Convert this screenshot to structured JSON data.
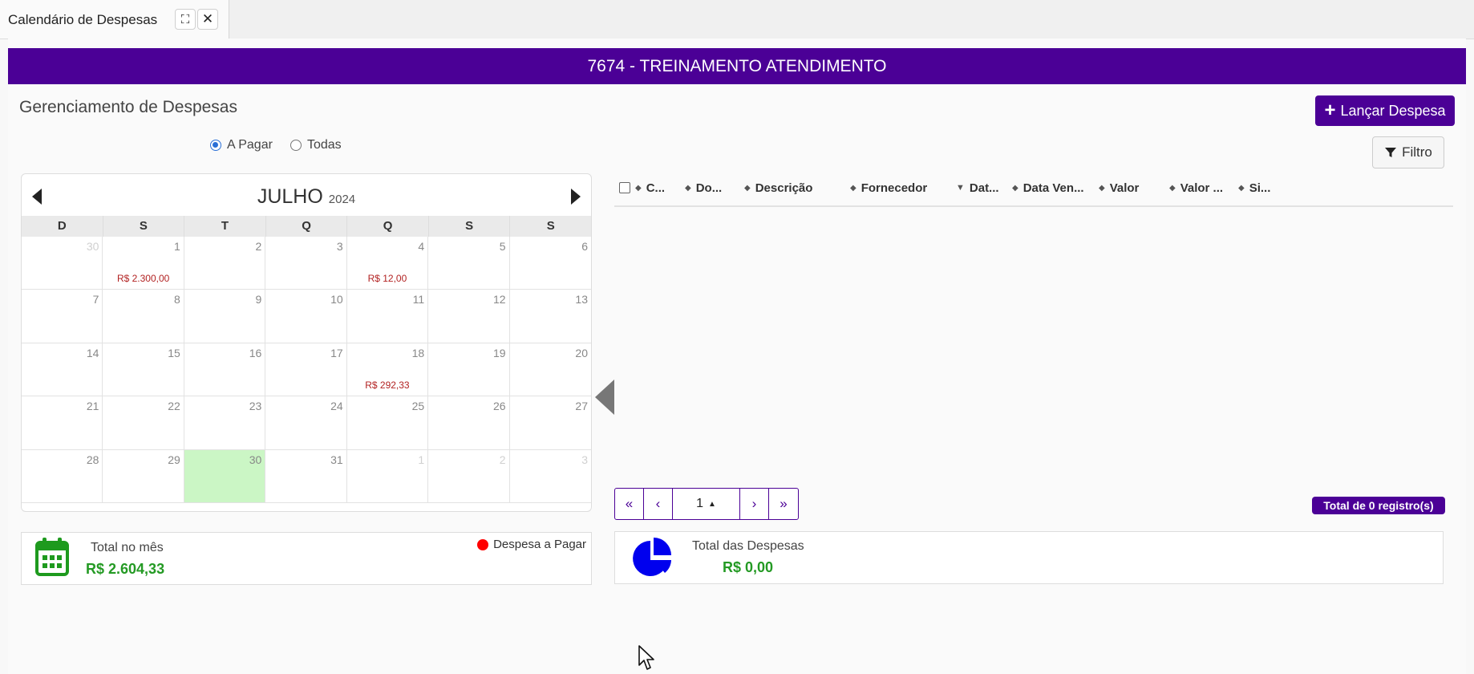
{
  "tab": {
    "title": "Calendário de Despesas",
    "expand_icon": "⛶",
    "close_icon": "✕"
  },
  "banner": {
    "title": "7674 - TREINAMENTO ATENDIMENTO"
  },
  "header": {
    "title": "Gerenciamento de Despesas",
    "add_button_label": "Lançar Despesa",
    "filter_button_label": "Filtro"
  },
  "filter_radio": {
    "options": [
      {
        "label": "A Pagar",
        "checked": true
      },
      {
        "label": "Todas",
        "checked": false
      }
    ]
  },
  "calendar": {
    "month": "JULHO",
    "year": "2024",
    "weekdays": [
      "D",
      "S",
      "T",
      "Q",
      "Q",
      "S",
      "S"
    ],
    "weeks": [
      [
        {
          "d": "30",
          "other": true
        },
        {
          "d": "1",
          "amount": "R$ 2.300,00"
        },
        {
          "d": "2"
        },
        {
          "d": "3"
        },
        {
          "d": "4",
          "amount": "R$ 12,00"
        },
        {
          "d": "5"
        },
        {
          "d": "6"
        }
      ],
      [
        {
          "d": "7"
        },
        {
          "d": "8"
        },
        {
          "d": "9"
        },
        {
          "d": "10"
        },
        {
          "d": "11"
        },
        {
          "d": "12"
        },
        {
          "d": "13"
        }
      ],
      [
        {
          "d": "14"
        },
        {
          "d": "15"
        },
        {
          "d": "16"
        },
        {
          "d": "17"
        },
        {
          "d": "18",
          "amount": "R$ 292,33"
        },
        {
          "d": "19"
        },
        {
          "d": "20"
        }
      ],
      [
        {
          "d": "21"
        },
        {
          "d": "22"
        },
        {
          "d": "23"
        },
        {
          "d": "24"
        },
        {
          "d": "25"
        },
        {
          "d": "26"
        },
        {
          "d": "27"
        }
      ],
      [
        {
          "d": "28"
        },
        {
          "d": "29"
        },
        {
          "d": "30",
          "today": true
        },
        {
          "d": "31"
        },
        {
          "d": "1",
          "other": true
        },
        {
          "d": "2",
          "other": true
        },
        {
          "d": "3",
          "other": true
        }
      ]
    ],
    "today_color": "#cbf6c5",
    "amount_color": "#b22222"
  },
  "table": {
    "columns": [
      "C...",
      "Do...",
      "Descrição",
      "Fornecedor",
      "Dat...",
      "Data Ven...",
      "Valor",
      "Valor ...",
      "Si..."
    ],
    "rows": []
  },
  "pagination": {
    "first": "«",
    "prev": "‹",
    "current": "1",
    "next": "›",
    "last": "»"
  },
  "records_badge": "Total de 0 registro(s)",
  "month_summary": {
    "label": "Total no mês",
    "value": "R$ 2.604,33",
    "legend_label": "Despesa a Pagar",
    "legend_color": "#ff0000",
    "icon": "calendar-icon"
  },
  "expenses_summary": {
    "label": "Total das Despesas",
    "value": "R$ 0,00",
    "icon": "pie-chart-icon"
  },
  "colors": {
    "brand": "#4b0096",
    "positive": "#249a24"
  }
}
